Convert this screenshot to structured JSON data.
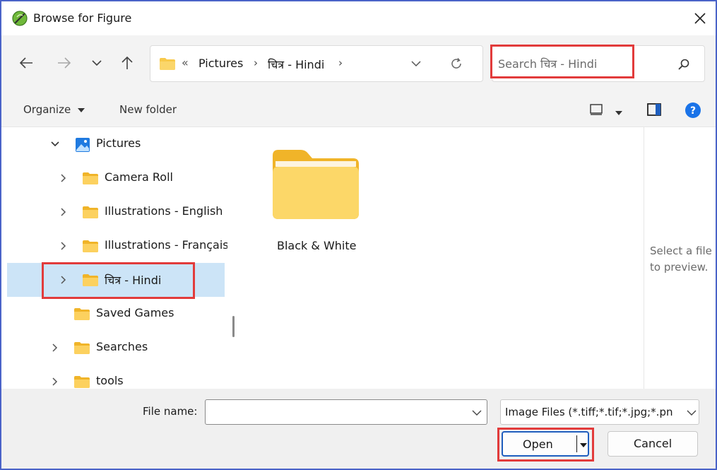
{
  "window": {
    "title": "Browse for Figure"
  },
  "address": {
    "crumbs": [
      "Pictures",
      "चित्र - Hindi"
    ]
  },
  "search": {
    "placeholder": "Search चित्र - Hindi"
  },
  "toolbar": {
    "organize_label": "Organize",
    "new_folder_label": "New folder"
  },
  "tree": {
    "items": [
      {
        "label": "Pictures",
        "expanded": true,
        "icon": "pictures-icon"
      },
      {
        "label": "Camera Roll",
        "icon": "folder-icon"
      },
      {
        "label": "Illustrations - English",
        "icon": "folder-icon"
      },
      {
        "label": "Illustrations - Français",
        "icon": "folder-icon"
      },
      {
        "label": "चित्र - Hindi",
        "icon": "folder-icon",
        "selected": true
      },
      {
        "label": "Saved Games",
        "icon": "folder-icon"
      },
      {
        "label": "Searches",
        "icon": "folder-icon"
      },
      {
        "label": "tools",
        "icon": "folder-icon"
      }
    ]
  },
  "content": {
    "items": [
      {
        "label": "Black & White",
        "icon": "folder-icon"
      }
    ]
  },
  "preview": {
    "text": "Select a file to preview."
  },
  "footer": {
    "file_name_label": "File name:",
    "file_name_value": "",
    "file_type": "Image Files (*.tiff;*.tif;*.jpg;*.pn",
    "open_label": "Open",
    "cancel_label": "Cancel"
  },
  "colors": {
    "callout": "#e23b3b",
    "selection": "#cce4f7",
    "accent": "#1f5fbf",
    "folder": "#f8c94a"
  }
}
